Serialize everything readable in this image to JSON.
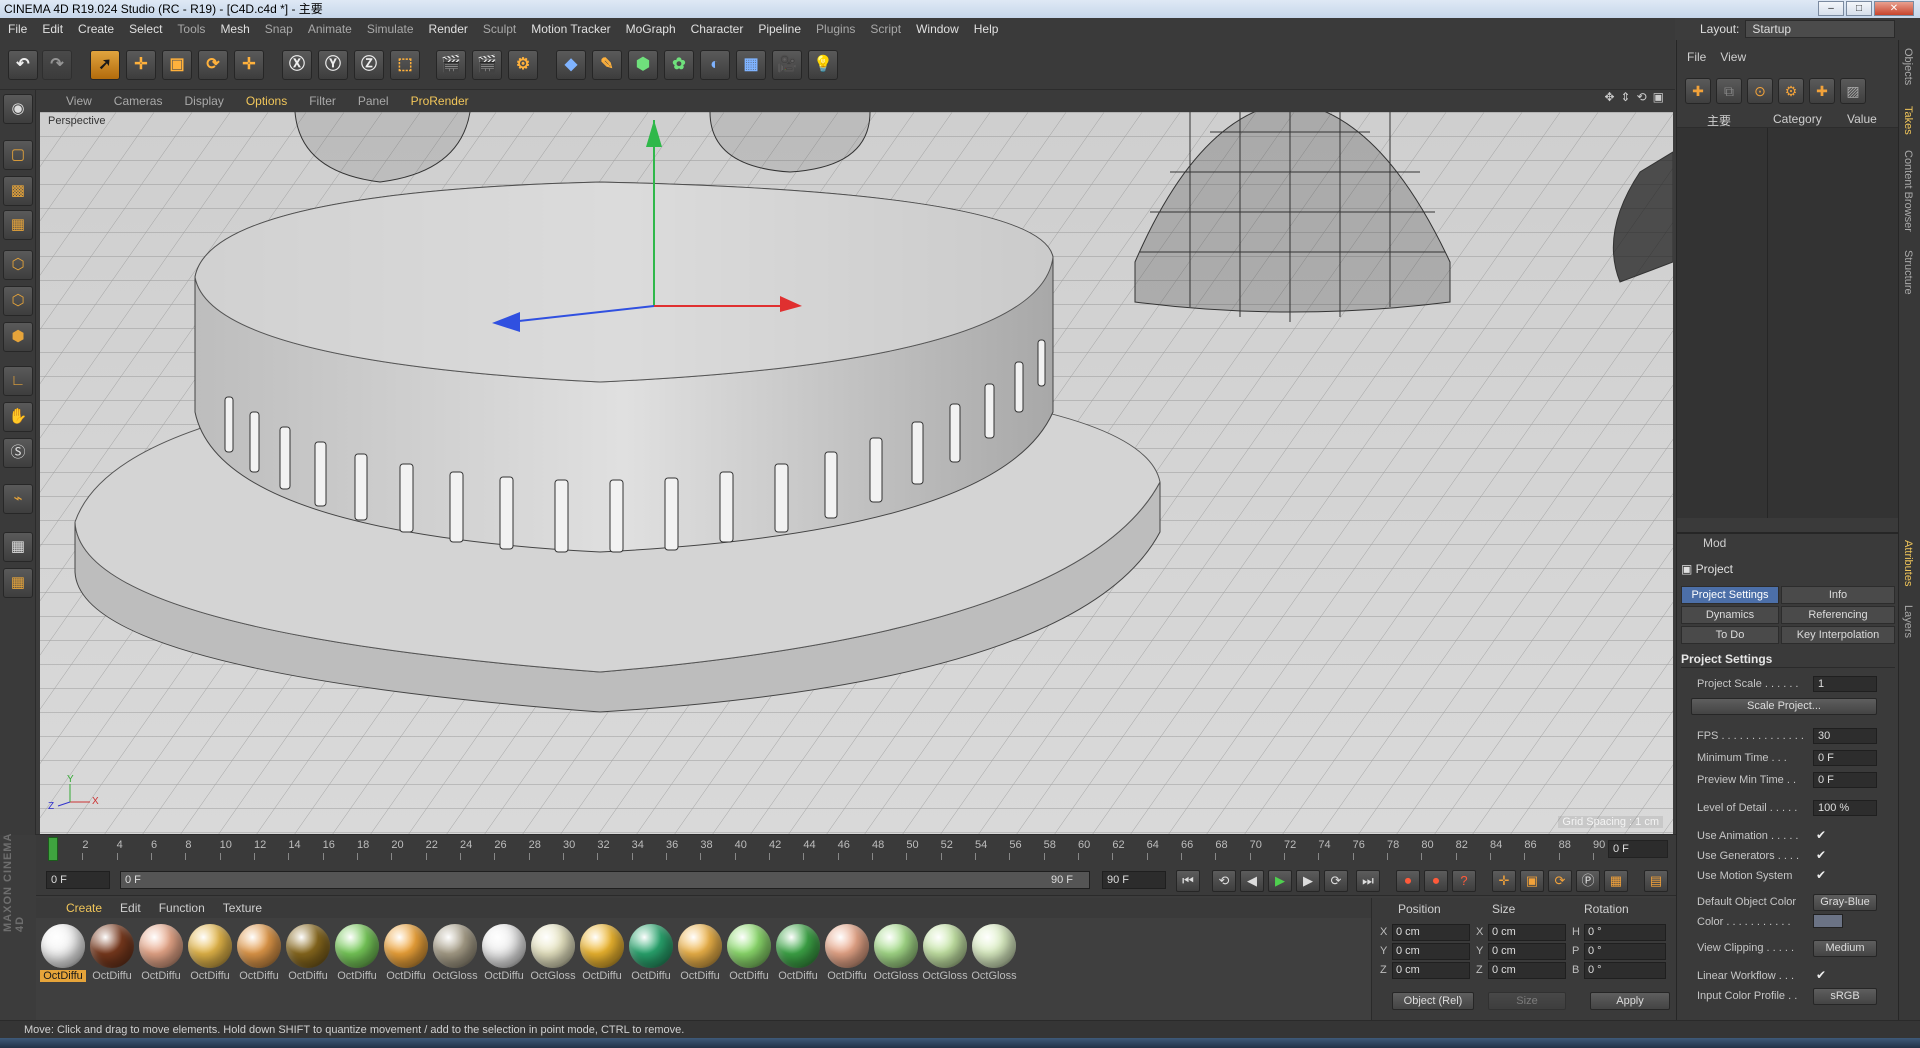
{
  "window": {
    "title": "CINEMA 4D R19.024 Studio (RC - R19) - [C4D.c4d *] - 主要"
  },
  "menu": [
    "File",
    "Edit",
    "Create",
    "Select",
    "Tools",
    "Mesh",
    "Snap",
    "Animate",
    "Simulate",
    "Render",
    "Sculpt",
    "Motion Tracker",
    "MoGraph",
    "Character",
    "Pipeline",
    "Plugins",
    "Script",
    "Window",
    "Help"
  ],
  "layout": {
    "label": "Layout:",
    "value": "Startup"
  },
  "viewport": {
    "menu": [
      "View",
      "Cameras",
      "Display",
      "Options",
      "Filter",
      "Panel",
      "ProRender"
    ],
    "camera_label": "Perspective",
    "grid_spacing": "Grid Spacing : 1 cm",
    "axis_x": "X",
    "axis_y": "Y",
    "axis_z": "Z"
  },
  "timeline": {
    "ticks": [
      "0",
      "2",
      "4",
      "6",
      "8",
      "10",
      "12",
      "14",
      "16",
      "18",
      "20",
      "22",
      "24",
      "26",
      "28",
      "30",
      "32",
      "34",
      "36",
      "38",
      "40",
      "42",
      "44",
      "46",
      "48",
      "50",
      "52",
      "54",
      "56",
      "58",
      "60",
      "62",
      "64",
      "66",
      "68",
      "70",
      "72",
      "74",
      "76",
      "78",
      "80",
      "82",
      "84",
      "86",
      "88",
      "90"
    ],
    "current_frame": "0 F",
    "start_field": "0 F",
    "range_start": "0 F",
    "range_end": "90 F",
    "end_field": "90 F"
  },
  "materials": {
    "menu": [
      "Create",
      "Edit",
      "Function",
      "Texture"
    ],
    "items": [
      {
        "label": "OctDiffu",
        "color": "#f4f4f4"
      },
      {
        "label": "OctDiffu",
        "color": "#7a3a1e"
      },
      {
        "label": "OctDiffu",
        "color": "#e9a88a"
      },
      {
        "label": "OctDiffu",
        "color": "#e6b84a"
      },
      {
        "label": "OctDiffu",
        "color": "#e39a4a"
      },
      {
        "label": "OctDiffu",
        "color": "#8a6a1e"
      },
      {
        "label": "OctDiffu",
        "color": "#78cc5a"
      },
      {
        "label": "OctDiffu",
        "color": "#f0a53a"
      },
      {
        "label": "OctGloss",
        "color": "#a9a08a"
      },
      {
        "label": "OctDiffu",
        "color": "#efefef"
      },
      {
        "label": "OctGloss",
        "color": "#e9e6c4"
      },
      {
        "label": "OctDiffu",
        "color": "#f0b830"
      },
      {
        "label": "OctDiffu",
        "color": "#2aa870"
      },
      {
        "label": "OctDiffu",
        "color": "#f0b54a"
      },
      {
        "label": "OctDiffu",
        "color": "#8ede6e"
      },
      {
        "label": "OctDiffu",
        "color": "#3ea848"
      },
      {
        "label": "OctDiffu",
        "color": "#eaa88a"
      },
      {
        "label": "OctGloss",
        "color": "#a6dd8a"
      },
      {
        "label": "OctGloss",
        "color": "#c6e6a6"
      },
      {
        "label": "OctGloss",
        "color": "#dcefc4"
      }
    ]
  },
  "coords": {
    "headers": [
      "Position",
      "Size",
      "Rotation"
    ],
    "axes_pos": [
      "X",
      "Y",
      "Z"
    ],
    "axes_rot": [
      "H",
      "P",
      "B"
    ],
    "pos": [
      "0 cm",
      "0 cm",
      "0 cm"
    ],
    "size": [
      "0 cm",
      "0 cm",
      "0 cm"
    ],
    "rot": [
      "0 °",
      "0 °",
      "0 °"
    ],
    "mode": "Object (Rel)",
    "size_mode": "Size",
    "apply": "Apply"
  },
  "status": "Move: Click and drag to move elements. Hold down SHIFT to quantize movement / add to the selection in point mode, CTRL to remove.",
  "objects": {
    "menu": [
      "File",
      "View"
    ],
    "cols": {
      "name": "主要",
      "category": "Category",
      "value": "Value"
    }
  },
  "attributes": {
    "menu": "Mod",
    "title": "Project",
    "tabs": [
      "Project Settings",
      "Info",
      "Dynamics",
      "Referencing",
      "To Do",
      "Key Interpolation"
    ],
    "section": "Project Settings",
    "rows": {
      "project_scale": "Project Scale . . . . . .",
      "project_scale_val": "1",
      "scale_project": "Scale Project...",
      "fps": "FPS . . . . . . . . . . . . . .",
      "fps_val": "30",
      "min_time": "Minimum Time . . .",
      "min_time_val": "0 F",
      "preview_min": "Preview Min Time . .",
      "preview_min_val": "0 F",
      "lod": "Level of Detail . . . . .",
      "lod_val": "100 %",
      "use_anim": "Use Animation . . . . .",
      "use_gen": "Use Generators . . . .",
      "use_motion": "Use Motion System",
      "default_color": "Default Object Color",
      "default_color_val": "Gray-Blue",
      "color": "Color . . . . . . . . . . .",
      "view_clip": "View Clipping . . . . .",
      "view_clip_val": "Medium",
      "linear_wf": "Linear Workflow . . .",
      "input_profile": "Input Color Profile . .",
      "input_profile_val": "sRGB"
    }
  },
  "side_tabs": [
    "Objects",
    "Takes",
    "Content Browser",
    "Structure",
    "Attributes",
    "Layers"
  ],
  "branding": "MAXON CINEMA 4D"
}
